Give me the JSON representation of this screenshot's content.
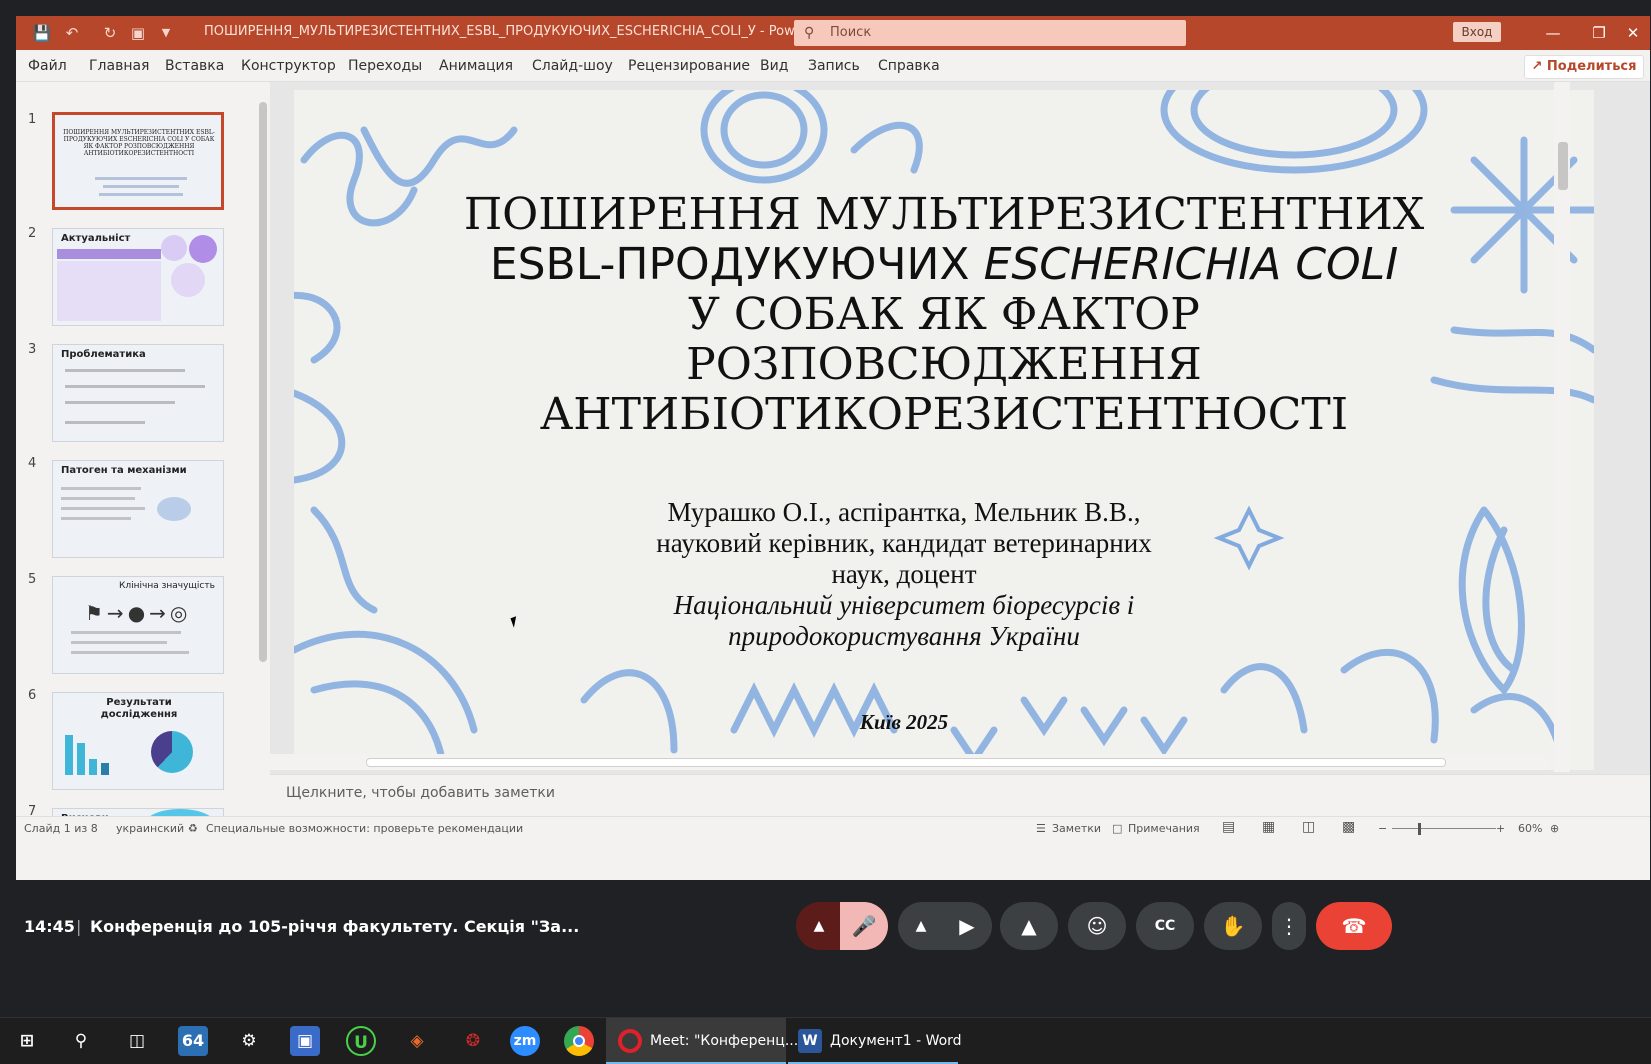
{
  "ppt": {
    "doc_title": "ПОШИРЕННЯ_МУЛЬТИРЕЗИСТЕНТНИХ_ESBL_ПРОДУКУЮЧИХ_ESCHERICHIA_COLI_У - PowerPoint",
    "search_placeholder": "Поиск",
    "login_label": "Вход",
    "share_label": "Поделиться",
    "menu": [
      "Файл",
      "Главная",
      "Вставка",
      "Конструктор",
      "Переходы",
      "Анимация",
      "Слайд-шоу",
      "Рецензирование",
      "Вид",
      "Запись",
      "Справка"
    ],
    "thumbnails": [
      {
        "num": "1",
        "title": "ПОШИРЕННЯ МУЛЬТИРЕЗИСТЕНТНИХ ESBL-ПРОДУКУЮЧИХ ESCHERICHIA COLI У СОБАК ЯК ФАКТОР РОЗПОВСЮДЖЕННЯ АНТИБІОТИКОРЕЗИСТЕНТНОСТІ"
      },
      {
        "num": "2",
        "title": "Актуальніст"
      },
      {
        "num": "3",
        "title": "Проблематика"
      },
      {
        "num": "4",
        "title": "Патоген та механізми"
      },
      {
        "num": "5",
        "title": "Клінічна значущість"
      },
      {
        "num": "6",
        "title": "Результати дослідження"
      },
      {
        "num": "7",
        "title": "Висновк"
      }
    ],
    "slide": {
      "title_line1": "ПОШИРЕННЯ МУЛЬТИРЕЗИСТЕНТНИХ",
      "title_line2_a": "ESBL-ПРОДУКУЮЧИХ ",
      "title_line2_b": "ESCHERICHIA COLI",
      "title_line3": "У СОБАК ЯК ФАКТОР",
      "title_line4": "РОЗПОВСЮДЖЕННЯ",
      "title_line5": "АНТИБІОТИКОРЕЗИСТЕНТНОСТІ",
      "authors_line1": "Мурашко О.І., аспірантка, Мельник В.В.,",
      "authors_line2": "науковий керівник, кандидат ветеринарних",
      "authors_line3": "наук, доцент",
      "uni_line1": "Національний університет біоресурсів і",
      "uni_line2": "природокористування України",
      "city_year": "Київ 2025"
    },
    "notes_placeholder": "Щелкните, чтобы добавить заметки",
    "status": {
      "slide_counter": "Слайд 1 из 8",
      "language": "украинский",
      "accessibility": "Специальные возможности: проверьте рекомендации",
      "notes_btn": "Заметки",
      "comments_btn": "Примечания",
      "zoom": "60%"
    }
  },
  "meet": {
    "time": "14:45",
    "separator": "|",
    "meeting_title": "Конференція до 105-річчя факультету. Секція \"За..."
  },
  "taskbar": {
    "badge_64": "64",
    "zoom_icon_text": "zm",
    "apps": [
      {
        "label": "Meet: \"Конференц..."
      },
      {
        "label": "Документ1 - Word"
      }
    ]
  }
}
